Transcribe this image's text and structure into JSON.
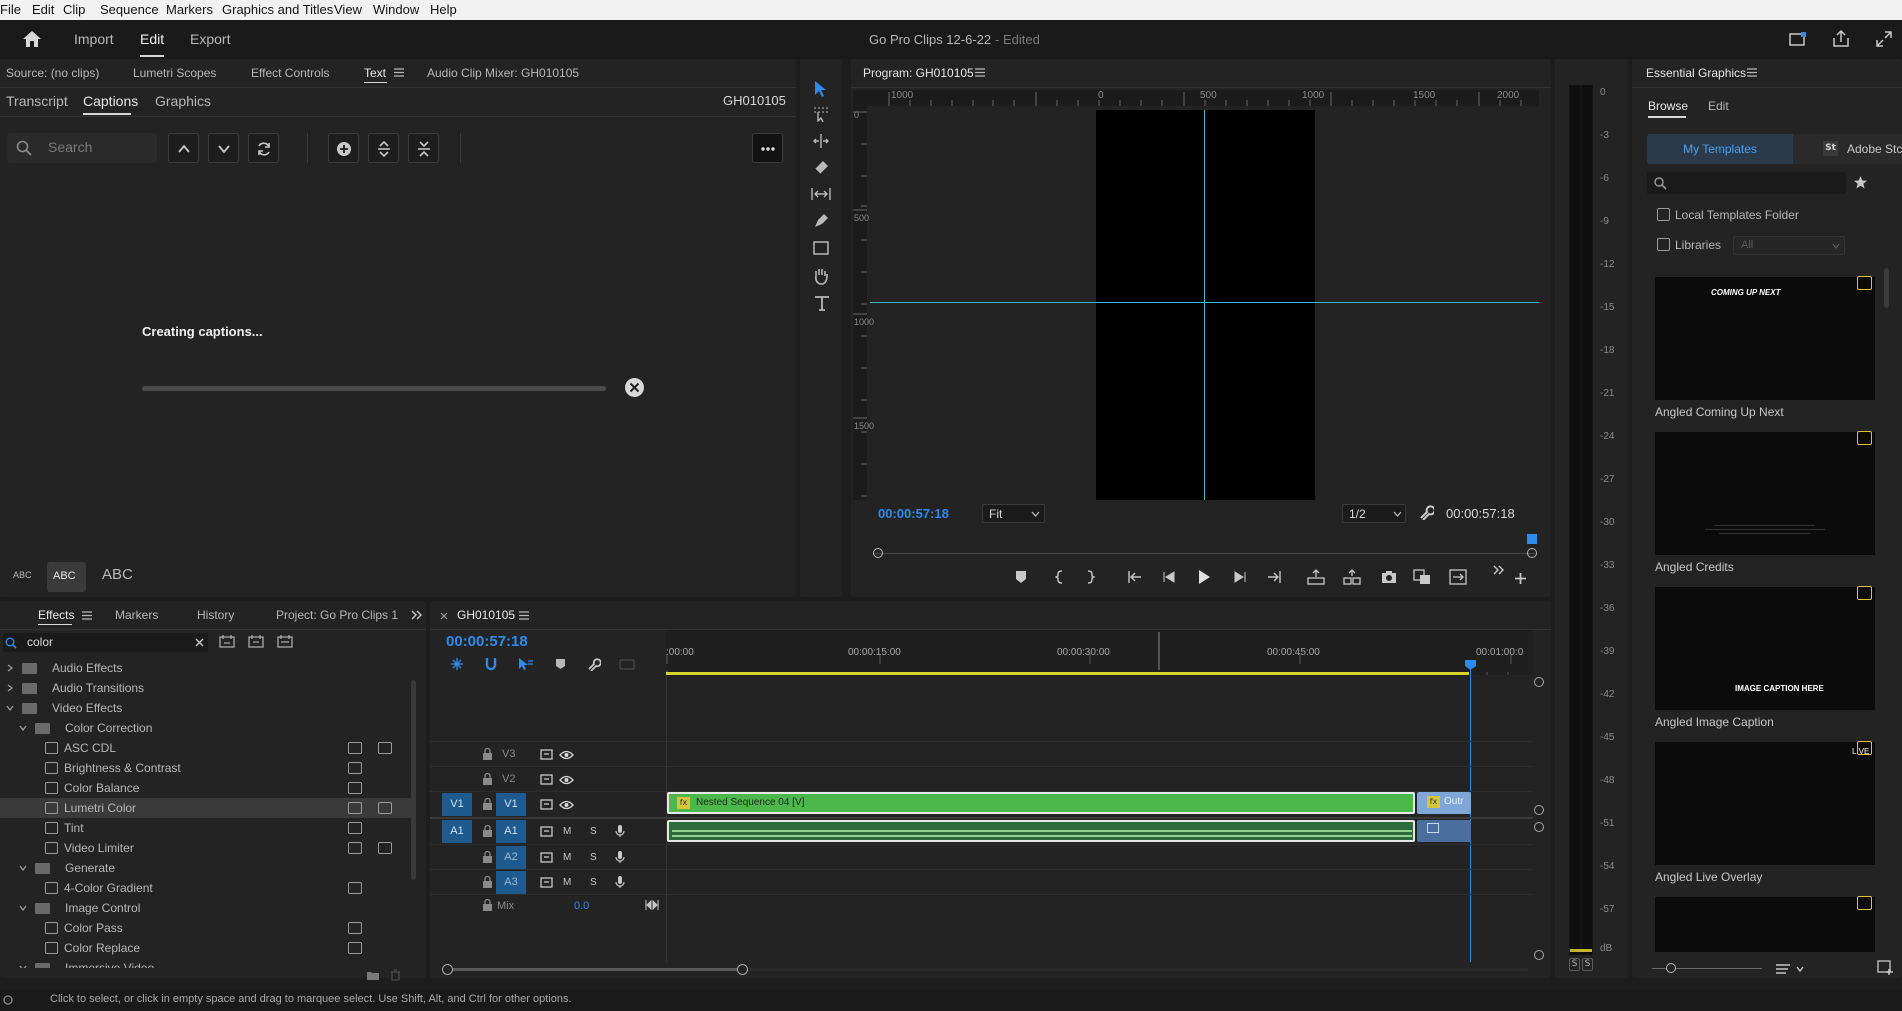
{
  "menu": {
    "items": [
      "File",
      "Edit",
      "Clip",
      "Sequence",
      "Markers",
      "Graphics and Titles",
      "View",
      "Window",
      "Help"
    ]
  },
  "appbar": {
    "import": "Import",
    "edit": "Edit",
    "export": "Export",
    "project_title": "Go Pro Clips 12-6-22",
    "edited": "- Edited"
  },
  "source_panel": {
    "tabs": [
      "Source: (no clips)",
      "Lumetri Scopes",
      "Effect Controls",
      "Text",
      "Audio Clip Mixer: GH010105"
    ],
    "subtabs": [
      "Transcript",
      "Captions",
      "Graphics"
    ],
    "clip": "GH010105",
    "search_placeholder": "Search",
    "status": "Creating captions...",
    "progress": 0.0,
    "text_sizes": [
      "ABC",
      "ABC",
      "ABC"
    ]
  },
  "program": {
    "title": "Program: GH010105",
    "ruler_top": [
      "1000",
      "0",
      "500",
      "1000",
      "1500",
      "2000"
    ],
    "ruler_left": [
      "0",
      "500",
      "1000",
      "1500"
    ],
    "timecode": "00:00:57:18",
    "fit": "Fit",
    "resolution": "1/2",
    "duration": "00:00:57:18"
  },
  "effects": {
    "tabs": [
      "Effects",
      "Markers",
      "History",
      "Project: Go Pro Clips 1"
    ],
    "search_value": "color",
    "tree": [
      {
        "label": "Audio Effects",
        "level": 0,
        "type": "folder",
        "open": false
      },
      {
        "label": "Audio Transitions",
        "level": 0,
        "type": "folder",
        "open": false
      },
      {
        "label": "Video Effects",
        "level": 0,
        "type": "folder",
        "open": true
      },
      {
        "label": "Color Correction",
        "level": 1,
        "type": "folder",
        "open": true
      },
      {
        "label": "ASC CDL",
        "level": 2,
        "type": "effect",
        "badges": 2
      },
      {
        "label": "Brightness & Contrast",
        "level": 2,
        "type": "effect",
        "badges": 1
      },
      {
        "label": "Color Balance",
        "level": 2,
        "type": "effect",
        "badges": 1
      },
      {
        "label": "Lumetri Color",
        "level": 2,
        "type": "effect",
        "badges": 2,
        "selected": true
      },
      {
        "label": "Tint",
        "level": 2,
        "type": "effect",
        "badges": 1
      },
      {
        "label": "Video Limiter",
        "level": 2,
        "type": "effect",
        "badges": 2
      },
      {
        "label": "Generate",
        "level": 1,
        "type": "folder",
        "open": true
      },
      {
        "label": "4-Color Gradient",
        "level": 2,
        "type": "effect",
        "badges": 1
      },
      {
        "label": "Image Control",
        "level": 1,
        "type": "folder",
        "open": true
      },
      {
        "label": "Color Pass",
        "level": 2,
        "type": "effect",
        "badges": 1
      },
      {
        "label": "Color Replace",
        "level": 2,
        "type": "effect",
        "badges": 1
      },
      {
        "label": "Immersive Video",
        "level": 1,
        "type": "folder",
        "open": true
      }
    ]
  },
  "timeline": {
    "sequence": "GH010105",
    "timecode": "00:00:57:18",
    "ruler": [
      ":00:00",
      "00:00:15:00",
      "00:00:30:00",
      "00:00:45:00",
      "00:01:00:0"
    ],
    "tracks": [
      {
        "name": "V3",
        "source": "",
        "type": "video"
      },
      {
        "name": "V2",
        "source": "",
        "type": "video"
      },
      {
        "name": "V1",
        "source": "V1",
        "type": "video"
      },
      {
        "name": "A1",
        "source": "A1",
        "type": "audio"
      },
      {
        "name": "A2",
        "source": "",
        "type": "audio"
      },
      {
        "name": "A3",
        "source": "",
        "type": "audio"
      }
    ],
    "mix_label": "Mix",
    "mix_value": "0.0",
    "clip_video": "Nested Sequence 04 [V]",
    "clip_video2": "Outr",
    "m": "M",
    "s": "S"
  },
  "audio_meter": {
    "scale": [
      "0",
      "-3",
      "-6",
      "-9",
      "-12",
      "-15",
      "-18",
      "-21",
      "-24",
      "-27",
      "-30",
      "-33",
      "-36",
      "-39",
      "-42",
      "-45",
      "-48",
      "-51",
      "-54",
      "-57",
      "dB"
    ],
    "s_left": "S",
    "s_right": "S"
  },
  "essential_graphics": {
    "title": "Essential Graphics",
    "tabs": [
      "Browse",
      "Edit"
    ],
    "template_tabs": [
      "My Templates",
      "Adobe Stc"
    ],
    "st": "St",
    "local": "Local Templates Folder",
    "libraries": "Libraries",
    "libraries_select": "All",
    "templates": [
      {
        "name": "Angled Coming Up Next",
        "preview": "COMING UP NEXT"
      },
      {
        "name": "Angled Credits",
        "preview": ""
      },
      {
        "name": "Angled Image Caption",
        "preview": "IMAGE CAPTION HERE"
      },
      {
        "name": "Angled Live Overlay",
        "preview": "LIVE"
      }
    ]
  },
  "status_bar": "Click to select, or click in empty space and drag to marquee select. Use Shift, Alt, and Ctrl for other options."
}
